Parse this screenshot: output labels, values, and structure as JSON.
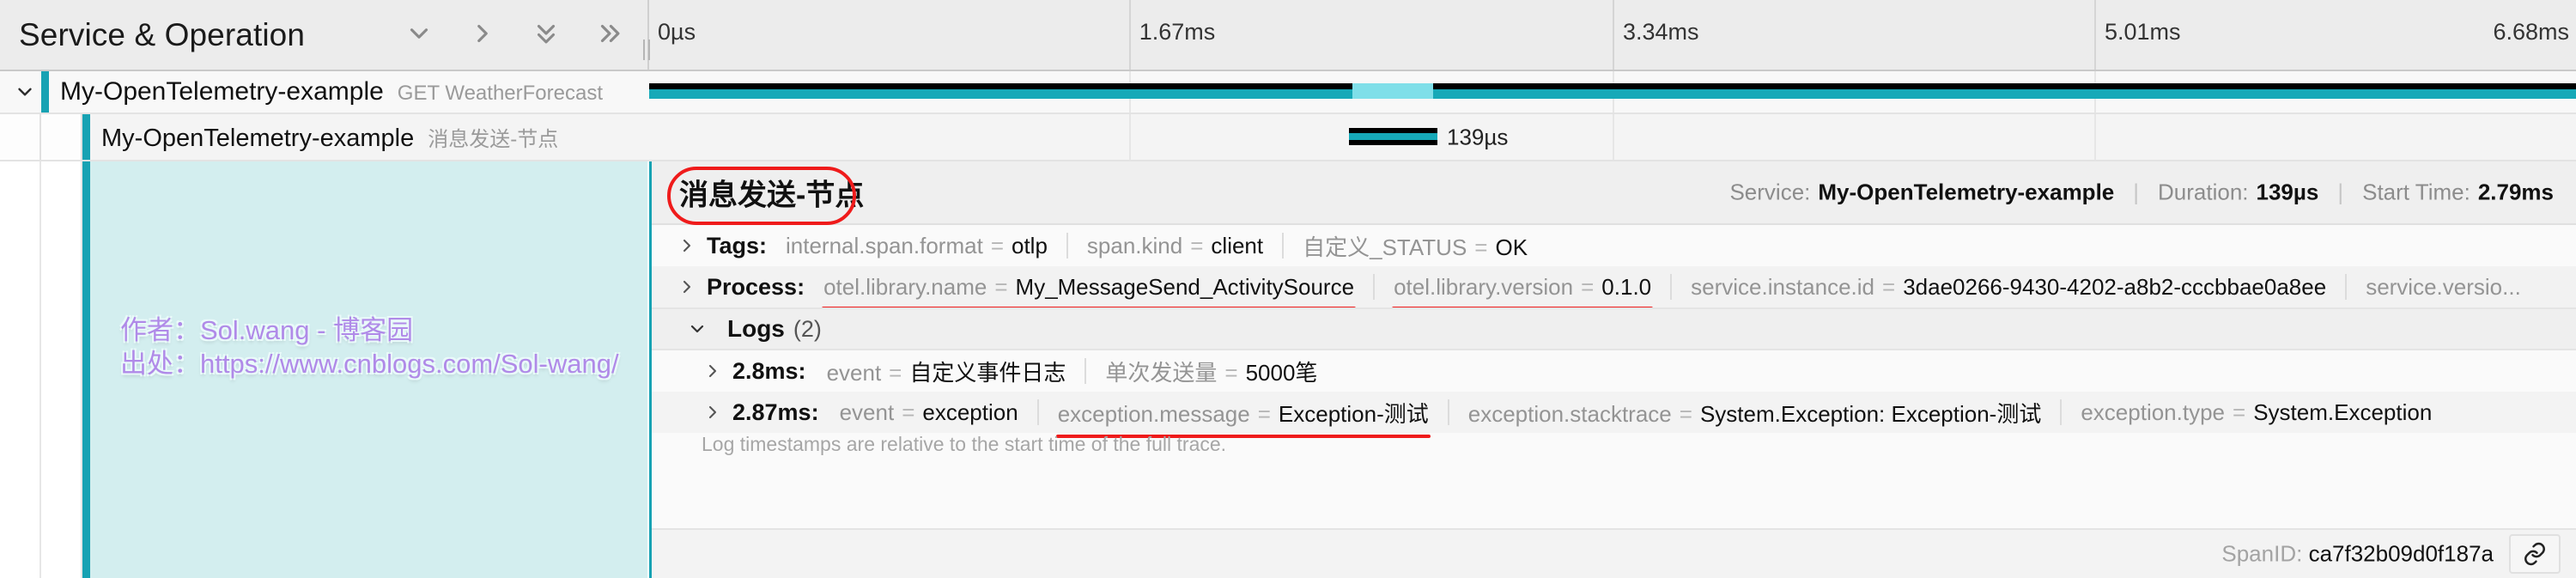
{
  "header": {
    "column_title": "Service & Operation",
    "controls": [
      {
        "name": "collapse-one-icon",
        "glyph": "chevron-down"
      },
      {
        "name": "expand-one-icon",
        "glyph": "chevron-right"
      },
      {
        "name": "collapse-all-icon",
        "glyph": "double-chevron-down"
      },
      {
        "name": "expand-all-icon",
        "glyph": "double-chevron-right"
      }
    ],
    "ticks": [
      "0µs",
      "1.67ms",
      "3.34ms",
      "5.01ms",
      "6.68ms"
    ]
  },
  "spans": [
    {
      "service": "My-OpenTelemetry-example",
      "operation": "GET WeatherForecast",
      "depth": 0,
      "expanded": true
    },
    {
      "service": "My-OpenTelemetry-example",
      "operation": "消息发送-节点",
      "depth": 1,
      "bar_label": "139µs"
    }
  ],
  "detail": {
    "title": "消息发送-节点",
    "service_label": "Service:",
    "service_value": "My-OpenTelemetry-example",
    "duration_label": "Duration:",
    "duration_value": "139µs",
    "start_label": "Start Time:",
    "start_value": "2.79ms",
    "tags": {
      "label": "Tags:",
      "items": [
        {
          "key": "internal.span.format",
          "value": "otlp",
          "underlined": false
        },
        {
          "key": "span.kind",
          "value": "client",
          "underlined": false
        },
        {
          "key": "自定义_STATUS",
          "value": "OK",
          "underlined": true
        }
      ]
    },
    "process": {
      "label": "Process:",
      "items": [
        {
          "key": "otel.library.name",
          "value": "My_MessageSend_ActivitySource",
          "underlined": true
        },
        {
          "key": "otel.library.version",
          "value": "0.1.0",
          "underlined": true
        },
        {
          "key": "service.instance.id",
          "value": "3dae0266-9430-4202-a8b2-cccbbae0a8ee",
          "underlined": false
        },
        {
          "key": "service.versio...",
          "value": "",
          "underlined": false
        }
      ]
    },
    "logs": {
      "title": "Logs",
      "count": "(2)",
      "note": "Log timestamps are relative to the start time of the full trace.",
      "entries": [
        {
          "timestamp": "2.8ms:",
          "fields": [
            {
              "key": "event",
              "value": "自定义事件日志",
              "underlined": true
            },
            {
              "key": "单次发送量",
              "value": "5000笔",
              "underlined": true
            }
          ]
        },
        {
          "timestamp": "2.87ms:",
          "fields": [
            {
              "key": "event",
              "value": "exception",
              "underlined": false
            },
            {
              "key": "exception.message",
              "value": "Exception-测试",
              "underlined": true
            },
            {
              "key": "exception.stacktrace",
              "value": "System.Exception: Exception-测试",
              "underlined": false
            },
            {
              "key": "exception.type",
              "value": "System.Exception",
              "underlined": false
            }
          ]
        }
      ]
    },
    "footer": {
      "spanid_label": "SpanID:",
      "spanid_value": "ca7f32b09d0f187a",
      "link_icon": "link-icon"
    }
  },
  "watermark": {
    "line1": "作者：Sol.wang - 博客园",
    "line2": "出处：https://www.cnblogs.com/Sol-wang/"
  },
  "colors": {
    "accent_teal": "#17a2b3",
    "annotation_red": "#ef1b1b",
    "watermark_purple": "#b08ae8"
  }
}
